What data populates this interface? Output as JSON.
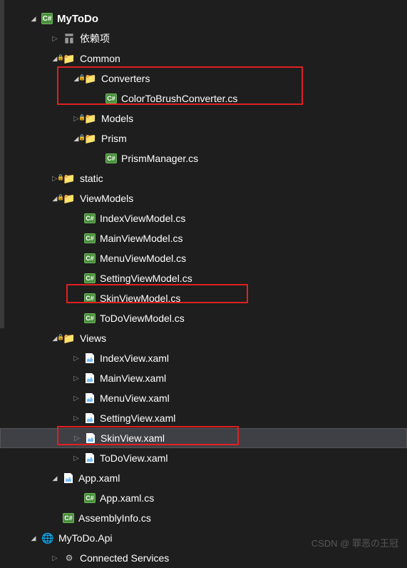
{
  "project": {
    "name": "MyToDo"
  },
  "deps": {
    "label": "依赖项"
  },
  "folders": {
    "common": "Common",
    "converters": "Converters",
    "models": "Models",
    "prism": "Prism",
    "static": "static",
    "viewmodels": "ViewModels",
    "views": "Views"
  },
  "files": {
    "colorconv": "ColorToBrushConverter.cs",
    "prismmgr": "PrismManager.cs",
    "indexvm": "IndexViewModel.cs",
    "mainvm": "MainViewModel.cs",
    "menuvm": "MenuViewModel.cs",
    "settingvm": "SettingViewModel.cs",
    "skinvm": "SkinViewModel.cs",
    "todovm": "ToDoViewModel.cs",
    "indexview": "IndexView.xaml",
    "mainview": "MainView.xaml",
    "menuview": "MenuView.xaml",
    "settingview": "SettingView.xaml",
    "skinview": "SkinView.xaml",
    "todoview": "ToDoView.xaml",
    "appxaml": "App.xaml",
    "appcs": "App.xaml.cs",
    "asminfo": "AssemblyInfo.cs"
  },
  "project2": {
    "name": "MyToDo.Api"
  },
  "connsvc": {
    "label": "Connected Services"
  },
  "watermark": "CSDN @ 罪恶の王冠"
}
